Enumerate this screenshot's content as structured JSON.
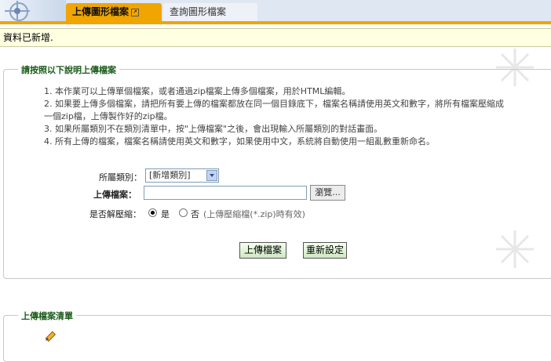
{
  "tabs": {
    "active": "上傳圖形檔案",
    "other": "查詢圖形檔案"
  },
  "status": "資料已新增.",
  "upload_section": {
    "legend": "請按照以下說明上傳檔案",
    "instructions": [
      "1. 本作業可以上傳單個檔案，或者通過zip檔案上傳多個檔案，用於HTML編輯。",
      "2. 如果要上傳多個檔案，請把所有要上傳的檔案都放在同一個目錄底下，檔案名稱請使用英文和數字，將所有檔案壓縮成",
      "一個zip檔，上傳製作好的zip檔。",
      "3. 如果所屬類別不在類別清單中，按\"上傳檔案\"之後，會出現輸入所屬類別的對話畫面。",
      "4. 所有上傳的檔案，檔案名稱請使用英文和數字，如果使用中文，系統將自動使用一組亂數重新命名。"
    ],
    "category_label": "所屬類別：",
    "category_value": "[新增類別]",
    "file_label": "上傳檔案：",
    "file_value": "",
    "browse_label": "瀏覽...",
    "unzip_label": "是否解壓縮：",
    "yes_label": "是",
    "no_label": "否",
    "unzip_note": "(上傳壓縮檔(*.zip)時有效)",
    "unzip_selected": "yes",
    "submit_label": "上傳檔案",
    "reset_label": "重新設定"
  },
  "list_section": {
    "legend": "上傳檔案清單"
  },
  "icons": {
    "upload_list_icon": "upload-pencil-icon",
    "decoration": "snowflake-icon"
  },
  "colors": {
    "tab_active": "#f0a500",
    "status_bg": "#ffffe1",
    "legend_text": "#1a5a1a",
    "button_bg": "#cfe8c0"
  }
}
